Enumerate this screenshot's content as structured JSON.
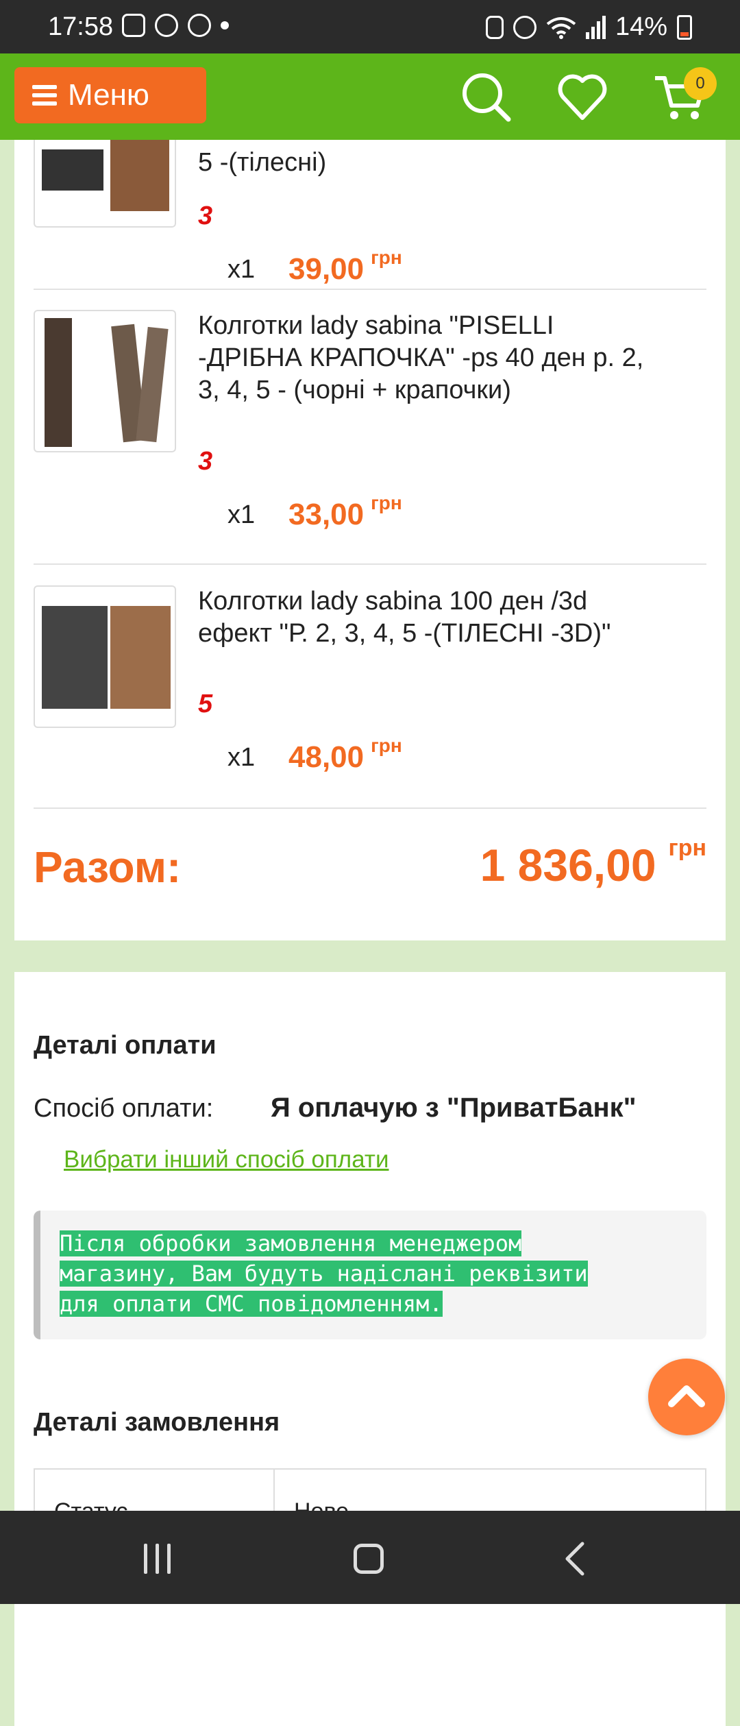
{
  "status_bar": {
    "time": "17:58",
    "battery": "14%"
  },
  "header": {
    "menu_label": "Меню",
    "cart_count": "0"
  },
  "items": [
    {
      "name": "5 -(тілесні)",
      "qty": "3",
      "mult": "x1",
      "price": "39,00",
      "currency": "грн"
    },
    {
      "name": "Колготки lady sabina \"PISELLI -ДРІБНА КРАПОЧКА\" -ps 40 ден р. 2, 3, 4, 5 - (чорні + крапочки)",
      "qty": "3",
      "mult": "x1",
      "price": "33,00",
      "currency": "грн"
    },
    {
      "name": "Колготки lady sabina 100 ден /3d ефект \"Р. 2, 3, 4, 5 -(ТІЛЕСНІ -3D)\"",
      "qty": "5",
      "mult": "x1",
      "price": "48,00",
      "currency": "грн"
    }
  ],
  "total": {
    "label": "Разом:",
    "value": "1 836,00",
    "currency": "грн"
  },
  "payment": {
    "title": "Деталі оплати",
    "method_label": "Спосіб оплати:",
    "method_value": "Я оплачую з \"ПриватБанк\"",
    "change_link": "Вибрати інший спосіб оплати",
    "notice": "Після обробки замовлення менеджером\nмагазину, Вам будуть надіслані реквізити\nдля оплати СМС повідомленням."
  },
  "order": {
    "title": "Деталі замовлення",
    "status_label": "Статус",
    "status_value": "Нове"
  }
}
